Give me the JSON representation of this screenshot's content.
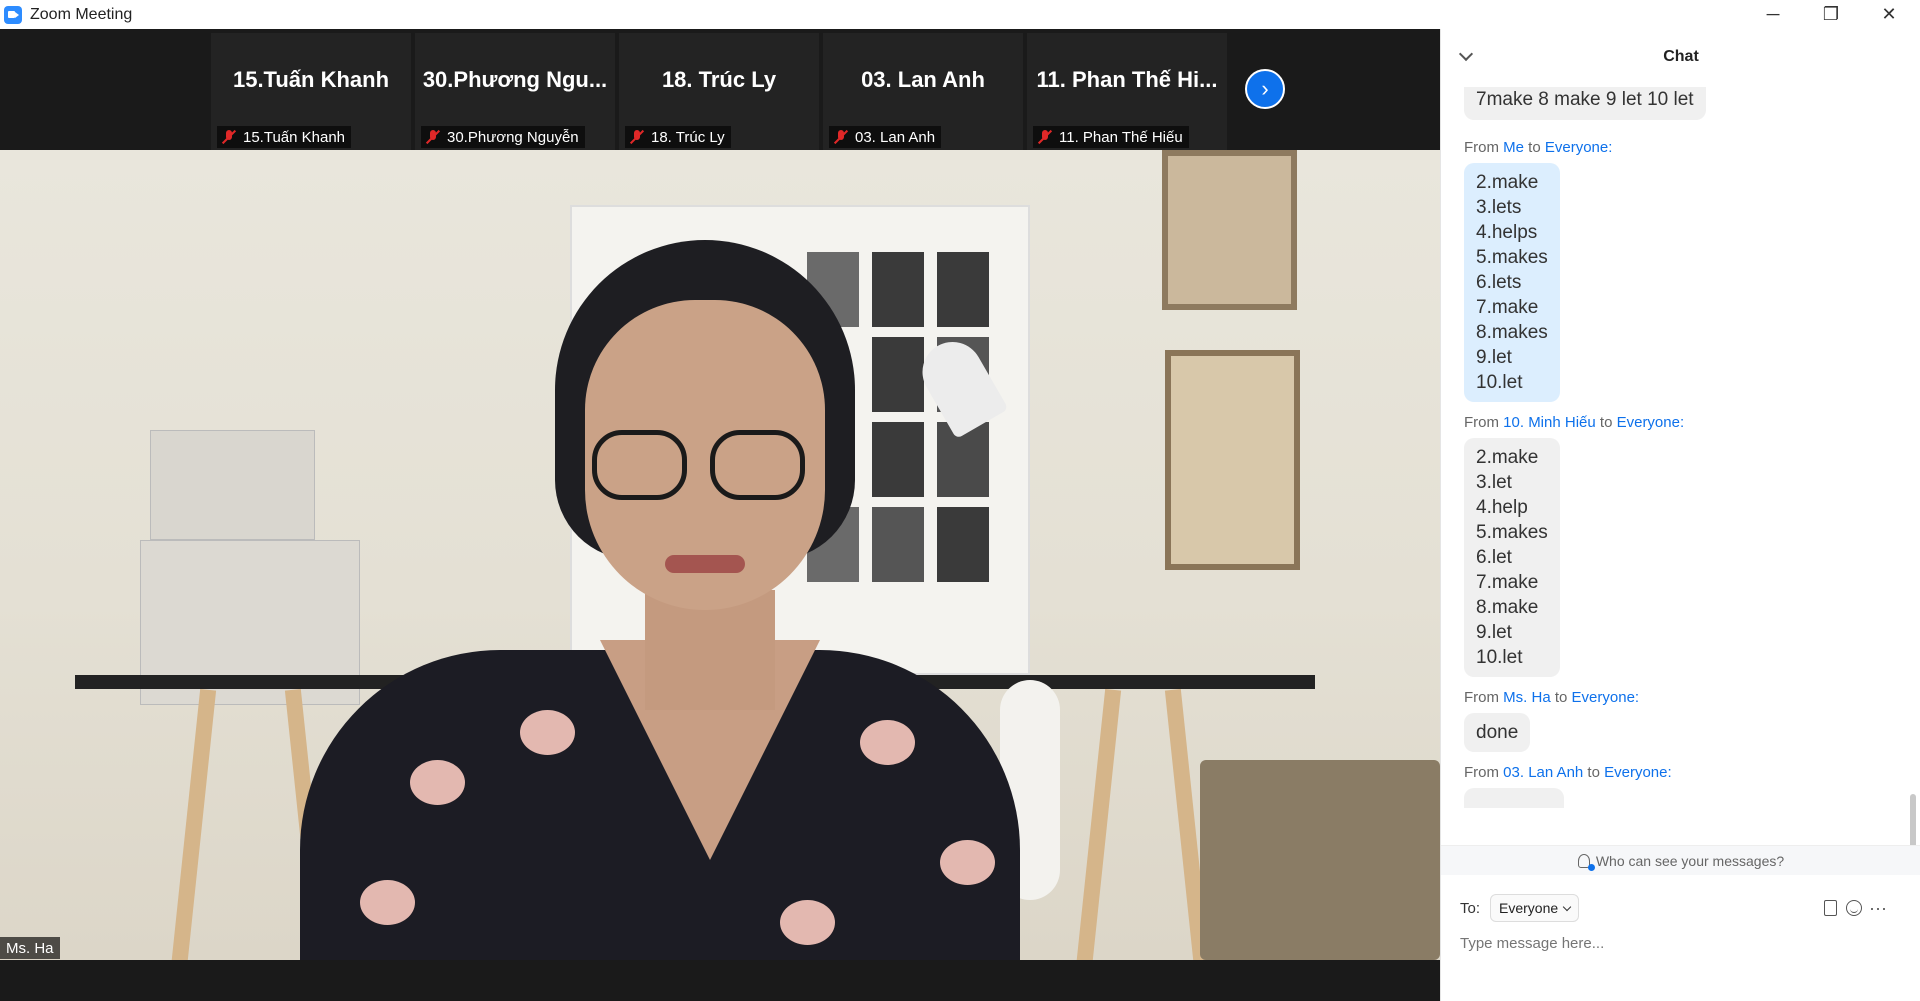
{
  "window": {
    "title": "Zoom Meeting",
    "minimize_glyph": "─",
    "restore_glyph": "❐",
    "close_glyph": "✕"
  },
  "participants_strip": {
    "tiles": [
      {
        "display_name": "15.Tuấn Khanh",
        "label": "15.Tuấn Khanh",
        "muted": true
      },
      {
        "display_name": "30.Phương Ngu...",
        "label": "30.Phương Nguyễn",
        "muted": true
      },
      {
        "display_name": "18. Trúc Ly",
        "label": "18. Trúc Ly",
        "muted": true
      },
      {
        "display_name": "03. Lan Anh",
        "label": "03. Lan Anh",
        "muted": true
      },
      {
        "display_name": "11. Phan Thế Hi...",
        "label": "11. Phan Thế Hiếu",
        "muted": true
      }
    ],
    "next_icon": "chevron-right-icon",
    "next_glyph": "›"
  },
  "main_video": {
    "speaker_name": "Ms. Ha"
  },
  "chat": {
    "title": "Chat",
    "messages": [
      {
        "partial_text": "7make 8 make 9 let 10 let"
      },
      {
        "from_prefix": "From ",
        "sender": "Me",
        "to_word": " to ",
        "recipient": "Everyone",
        "colon": ":",
        "text": "2.make\n3.lets\n4.helps\n5.makes\n6.lets\n7.make\n8.makes\n9.let\n10.let"
      },
      {
        "from_prefix": "From ",
        "sender": "10. Minh Hiếu",
        "to_word": " to ",
        "recipient": "Everyone",
        "colon": ":",
        "text": "2.make\n3.let\n4.help\n5.makes\n6.let\n7.make\n8.make\n9.let\n10.let"
      },
      {
        "from_prefix": "From ",
        "sender": "Ms. Ha",
        "to_word": " to ",
        "recipient": "Everyone",
        "colon": ":",
        "text": "done"
      },
      {
        "from_prefix": "From ",
        "sender": "03. Lan Anh",
        "to_word": " to ",
        "recipient": "Everyone",
        "colon": ":"
      }
    ],
    "visibility_note": "Who can see your messages?",
    "to_label": "To:",
    "to_value": "Everyone",
    "input_placeholder": "Type message here...",
    "more_glyph": "···"
  },
  "colors": {
    "accent": "#0e71eb",
    "mine_bubble": "#dceefe",
    "muted_red": "#e02828"
  }
}
